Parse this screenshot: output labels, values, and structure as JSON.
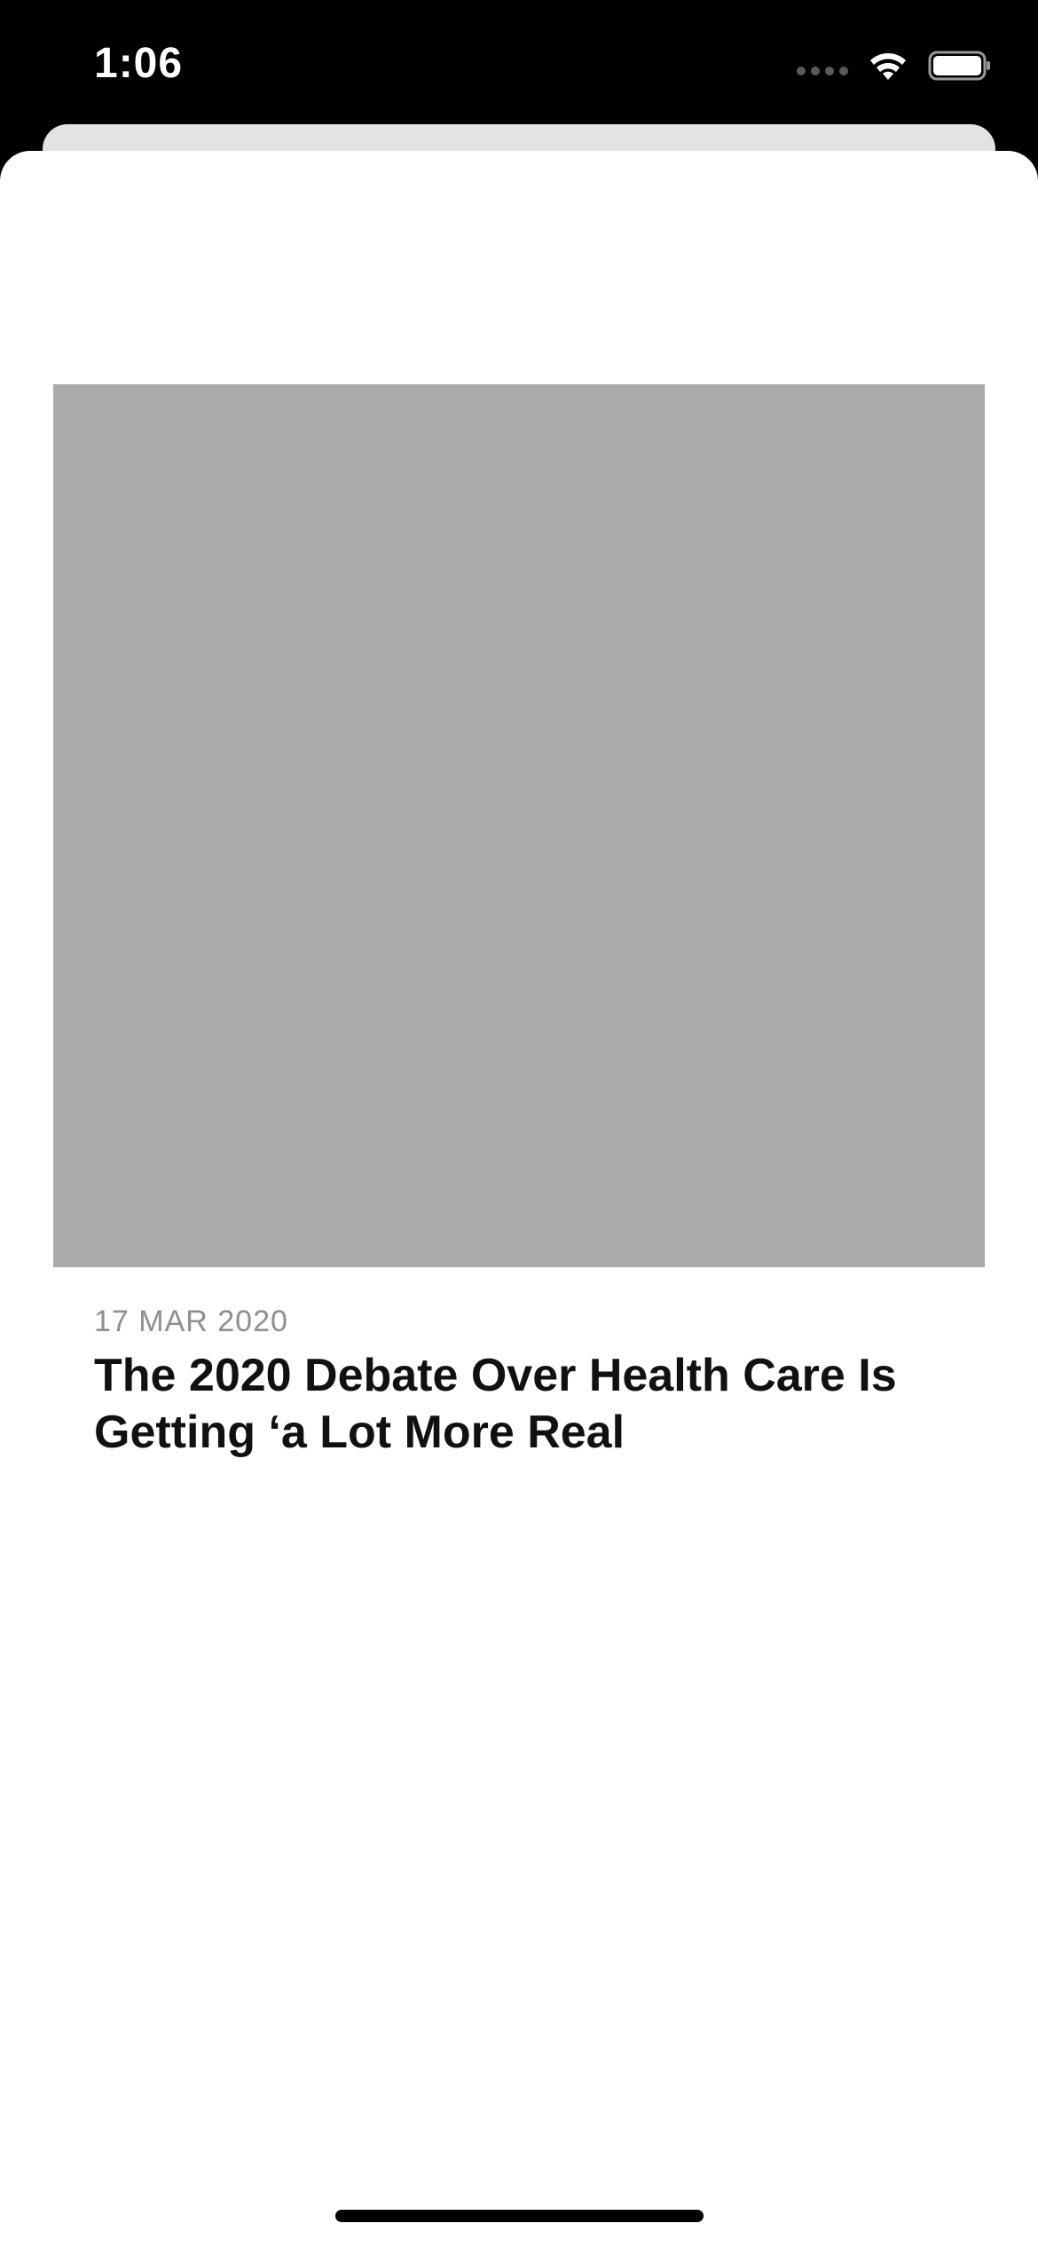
{
  "status_bar": {
    "time": "1:06",
    "icons": [
      "cellular-signal-icon",
      "wifi-icon",
      "battery-icon"
    ]
  },
  "article": {
    "image": "image-placeholder",
    "date": "17 MAR 2020",
    "title": "The 2020 Debate Over Health Care Is Getting ‘a Lot More Real"
  },
  "colors": {
    "status_bar_bg": "#000000",
    "sheet_bg": "#ffffff",
    "image_placeholder": "#aaaaaa",
    "date_text": "#8e8e93",
    "title_text": "#111111"
  }
}
